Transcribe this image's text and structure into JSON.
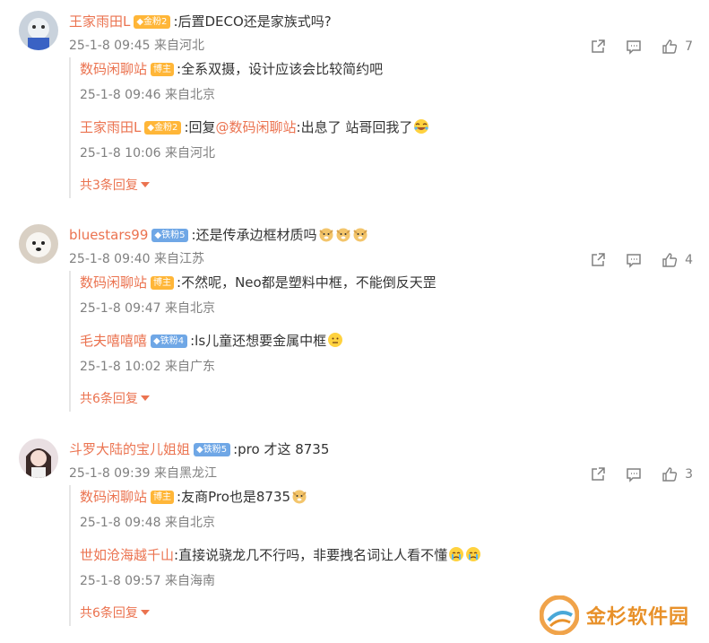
{
  "comments": [
    {
      "user": "王家雨田L",
      "badge": "金粉2",
      "badge_type": "gold",
      "text": ":后置DECO还是家族式吗?",
      "time": "25-1-8 09:45",
      "location": "来自河北",
      "likes": "7",
      "replies": [
        {
          "user": "数码闲聊站",
          "badge": "博主",
          "badge_type": "host",
          "text": ":全系双摄，设计应该会比较简约吧",
          "emojis": [],
          "time": "25-1-8 09:46",
          "location": "来自北京"
        },
        {
          "user": "王家雨田L",
          "badge": "金粉2",
          "badge_type": "gold",
          "text_pre": ":回复",
          "mention": "@数码闲聊站",
          "text": ":出息了 站哥回我了",
          "emojis": [
            "laugh-cry"
          ],
          "time": "25-1-8 10:06",
          "location": "来自河北"
        }
      ],
      "more": "共3条回复"
    },
    {
      "user": "bluestars99",
      "badge": "铁粉5",
      "badge_type": "iron",
      "text": ":还是传承边框材质吗",
      "emojis": [
        "doge",
        "doge",
        "doge"
      ],
      "time": "25-1-8 09:40",
      "location": "来自江苏",
      "likes": "4",
      "replies": [
        {
          "user": "数码闲聊站",
          "badge": "博主",
          "badge_type": "host",
          "text": ":不然呢，Neo都是塑料中框，不能倒反天罡",
          "emojis": [],
          "time": "25-1-8 09:47",
          "location": "来自北京"
        },
        {
          "user": "毛夫嘻嘻嘻",
          "badge": "铁粉4",
          "badge_type": "iron",
          "text": ":ls儿童还想要金属中框",
          "emojis": [
            "think"
          ],
          "time": "25-1-8 10:02",
          "location": "来自广东"
        }
      ],
      "more": "共6条回复"
    },
    {
      "user": "斗罗大陆的宝儿姐姐",
      "badge": "铁粉5",
      "badge_type": "iron",
      "text": ":pro 才这 8735",
      "time": "25-1-8 09:39",
      "location": "来自黑龙江",
      "likes": "3",
      "replies": [
        {
          "user": "数码闲聊站",
          "badge": "博主",
          "badge_type": "host",
          "text": ":友商Pro也是8735",
          "emojis": [
            "doge"
          ],
          "time": "25-1-8 09:48",
          "location": "来自北京"
        },
        {
          "user": "世如沧海越千山",
          "badge": "",
          "badge_type": "",
          "text": ":直接说骁龙几不行吗，非要拽名词让人看不懂",
          "emojis": [
            "cry",
            "cry"
          ],
          "time": "25-1-8 09:57",
          "location": "来自海南"
        }
      ],
      "more": "共6条回复"
    }
  ],
  "watermark": "金杉软件园",
  "colors": {
    "username": "#eb7350",
    "meta": "#808080",
    "gold_badge": "#ffb638",
    "iron_badge": "#6fa7e6"
  }
}
